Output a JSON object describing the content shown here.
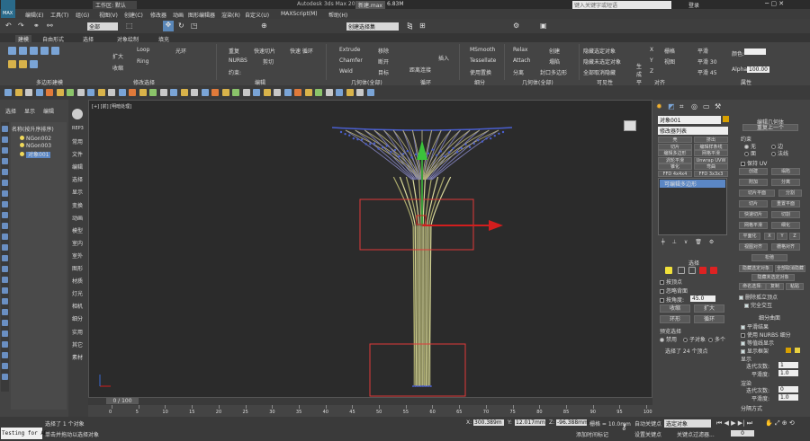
{
  "app": {
    "title": "Autodesk 3ds Max 2016",
    "file": "新建.max",
    "mem": "6.83M",
    "workspace": "工作区: 默认",
    "search_placeholder": "键入关键字或短语",
    "login": "登录",
    "logo": "MAX"
  },
  "menu": [
    "编辑(E)",
    "工具(T)",
    "组(G)",
    "视图(V)",
    "创建(C)",
    "修改器",
    "动画",
    "图形编辑器",
    "渲染(R)",
    "自定义(U)",
    "MAXScript(M)",
    "帮助(H)"
  ],
  "toolbar": {
    "filter": "全部",
    "select_set": "创建选择集"
  },
  "ribbon": {
    "tabs": [
      "建模",
      "自由形式",
      "选择",
      "对象绘制",
      "填充"
    ],
    "groups": [
      "多边形建模",
      "修改选择",
      "编辑",
      "几何体(全部)",
      "循环",
      "细分",
      "几何体(全部)",
      "可见性",
      "对齐",
      "属性"
    ],
    "items": [
      "扩大",
      "收缩",
      "Loop",
      "Ring",
      "光环",
      "重复",
      "快速切片",
      "快速 循环",
      "NURBS",
      "剪切",
      "约束:",
      "Extrude",
      "Chamfer",
      "Weld",
      "移除",
      "断开",
      "目标",
      "插入",
      "距离连接",
      "MSmooth",
      "Tessellate",
      "使用置换",
      "Relax",
      "Attach",
      "分离",
      "创建",
      "塌陷",
      "封口多边形",
      "隐藏选定对象",
      "隐藏未选定对象",
      "全部取消隐藏",
      "生成平面",
      "X",
      "Y",
      "Z",
      "栅格",
      "视图",
      "平滑",
      "平滑 30",
      "平滑 45",
      "颜色:",
      "Alpha:",
      "100.00"
    ]
  },
  "scene": {
    "tabs": [
      "选择",
      "显示",
      "编辑"
    ],
    "tree": [
      "名称(按升序排序)",
      "NGon002",
      "NGon003",
      "对象001"
    ]
  },
  "vtabs": [
    "常用",
    "文件",
    "编辑",
    "选择",
    "显示",
    "变换",
    "动画",
    "模型",
    "室内",
    "室外",
    "图形",
    "材质",
    "灯光",
    "相机",
    "细分",
    "实用",
    "其它",
    "素材"
  ],
  "vtab_top": "REP3",
  "viewport": {
    "label": "[+] [前] [明暗处理]"
  },
  "right_panel": {
    "object_name": "对象001",
    "modifier_list": "修改器列表",
    "buttons": [
      "壳",
      "挤出",
      "切片",
      "编辑样条线",
      "编辑多边形",
      "网格平滑",
      "涡轮平滑",
      "Unwrap UVW",
      "锥化",
      "弯曲",
      "FFD 4x4x4",
      "FFD 3x3x3"
    ],
    "stack_item": "可编辑多边形",
    "select_title": "选择",
    "select_opts": [
      "按顶点",
      "忽略背面",
      "按角度:",
      "45.0"
    ],
    "shrink": "收缩",
    "grow": "扩大",
    "ring": "环形",
    "loop": "循环",
    "preview_sel": "预览选择",
    "preview_opts": [
      "禁用",
      "子对象",
      "多个"
    ],
    "status_sel": "选择了 24 个顶点",
    "editgeo_title": "编辑几何体",
    "repeat": "重复上一个",
    "constraints": [
      "约束",
      "无",
      "边",
      "面",
      "法线"
    ],
    "preserve_uv": "保持 UV",
    "geo_btns": [
      "创建",
      "塌陷",
      "附加",
      "分离",
      "切片平面",
      "分割",
      "切片",
      "重置平面",
      "快速切片",
      "切割",
      "网格平滑",
      "细化",
      "平面化",
      "X",
      "Y",
      "Z",
      "视图对齐",
      "栅格对齐",
      "松弛",
      "隐藏选定对象",
      "全部取消隐藏",
      "隐藏未选定对象",
      "命名选择:",
      "复制",
      "粘贴",
      "删除孤立顶点",
      "完全交互"
    ],
    "subdiv_title": "细分曲面",
    "subdiv_opts": [
      "平滑结果",
      "使用 NURBS 细分",
      "等值线显示",
      "显示框架",
      "显示",
      "迭代次数:",
      "1",
      "平滑度:",
      "1.0",
      "渲染",
      "迭代次数:",
      "0",
      "平滑度:",
      "1.0",
      "分隔方式"
    ]
  },
  "timeline": {
    "frame": "0 / 100",
    "ticks": [
      "0",
      "5",
      "10",
      "15",
      "20",
      "25",
      "30",
      "35",
      "40",
      "45",
      "50",
      "55",
      "60",
      "65",
      "70",
      "75",
      "80",
      "85",
      "90",
      "95",
      "100"
    ]
  },
  "status": {
    "script": "Testing for AD",
    "selected": "选择了 1 个对象",
    "prompt": "单击并拖动以选择对象",
    "x_label": "X:",
    "x": "300.389m",
    "y_label": "Y:",
    "y": "12.017mm",
    "z_label": "Z:",
    "z": "-96.388mm",
    "grid": "栅格 = 10.0mm",
    "add_time": "添加时间标记",
    "autokey": "自动关键点",
    "setkey": "设置关键点",
    "sel_obj": "选定对象",
    "key_filter": "关键点过滤器..."
  },
  "colors": {
    "accent": "#4a8fd9",
    "axis_red": "#d21e1e",
    "box": "#e03a3a",
    "wire": "#4a5fd0",
    "tube": "#cfcf8a",
    "swatch": "#d8a000"
  }
}
